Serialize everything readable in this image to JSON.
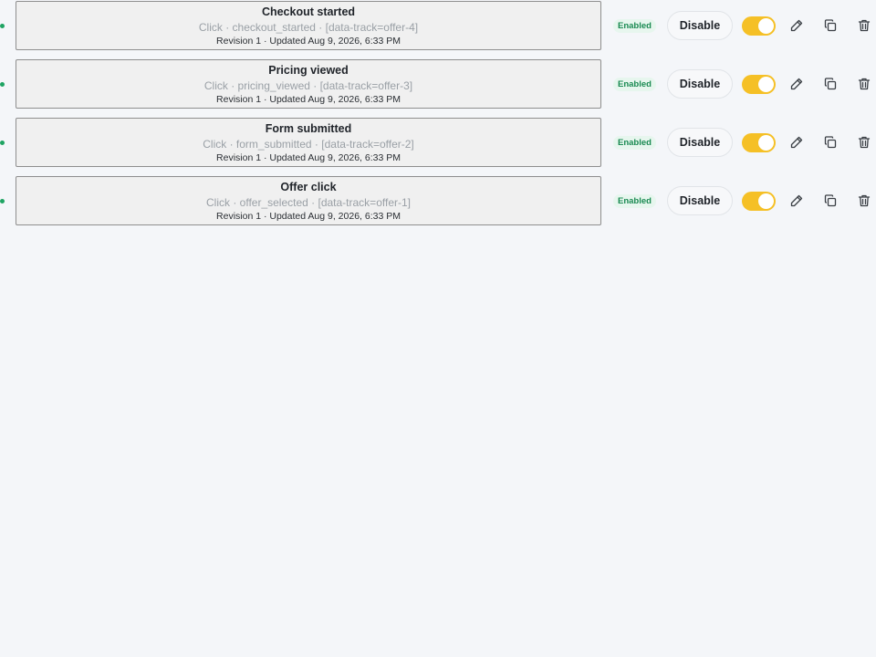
{
  "colors": {
    "status_dot": "#1fa463",
    "toggle_on": "#f5c026",
    "badge_bg": "#e7f6ee",
    "badge_text": "#1a8a52",
    "page_bg": "#f4f6f9"
  },
  "rows": [
    {
      "title": "Checkout started",
      "detail": "Click · checkout_started · [data-track=offer-4]",
      "meta": "Revision 1 · Updated Aug 9, 2026, 6:33 PM",
      "status": "Enabled",
      "action_label": "Disable",
      "toggle_on": true,
      "icons": [
        "pencil-icon",
        "copy-icon",
        "trash-icon"
      ]
    },
    {
      "title": "Pricing viewed",
      "detail": "Click · pricing_viewed · [data-track=offer-3]",
      "meta": "Revision 1 · Updated Aug 9, 2026, 6:33 PM",
      "status": "Enabled",
      "action_label": "Disable",
      "toggle_on": true,
      "icons": [
        "pencil-icon",
        "copy-icon",
        "trash-icon"
      ]
    },
    {
      "title": "Form submitted",
      "detail": "Click · form_submitted · [data-track=offer-2]",
      "meta": "Revision 1 · Updated Aug 9, 2026, 6:33 PM",
      "status": "Enabled",
      "action_label": "Disable",
      "toggle_on": true,
      "icons": [
        "pencil-icon",
        "copy-icon",
        "trash-icon"
      ]
    },
    {
      "title": "Offer click",
      "detail": "Click · offer_selected · [data-track=offer-1]",
      "meta": "Revision 1 · Updated Aug 9, 2026, 6:33 PM",
      "status": "Enabled",
      "action_label": "Disable",
      "toggle_on": true,
      "icons": [
        "pencil-icon",
        "copy-icon",
        "trash-icon"
      ]
    }
  ]
}
